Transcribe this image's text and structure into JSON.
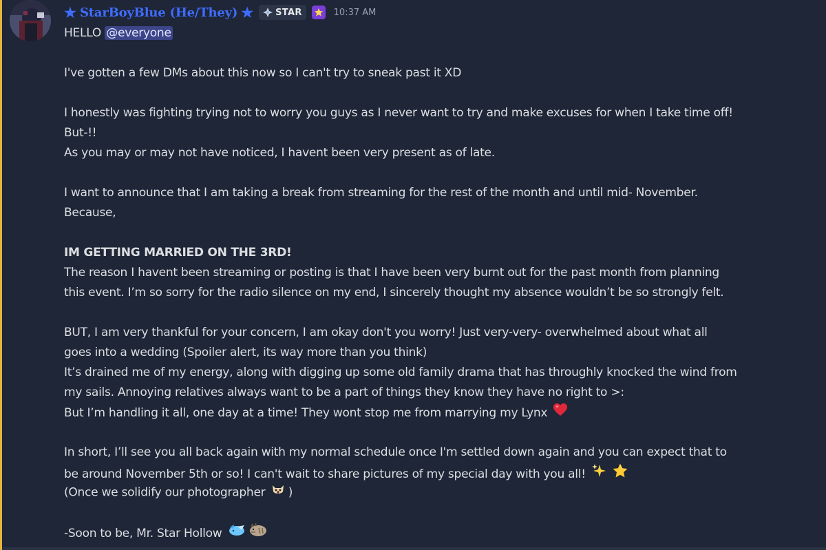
{
  "message": {
    "author": {
      "name": "StarBoyBlue (He/They)",
      "star_left": "★",
      "star_right": "★",
      "tag_label": "STAR",
      "role_icon": "star-badge-icon",
      "timestamp": "10:37 AM"
    },
    "colors": {
      "username": "#3f6cff",
      "mention_bg": "#3c4587",
      "accent_border": "#e3b53e",
      "background": "#1e2637"
    },
    "lines": {
      "l1_text": "HELLO ",
      "l1_mention": "@everyone",
      "l2": "I've gotten a few DMs about this now so I can't try to sneak past it XD",
      "l3": "I honestly was fighting trying not to worry you guys as I never want to try and make excuses for when I take time off!",
      "l4": "But-!!",
      "l5": "As you may or may not have noticed, I havent been very present as of late.",
      "l6": "I want to announce that I am taking a break from streaming for the rest of the month and until mid- November.",
      "l7": "Because,",
      "l8": "IM GETTING MARRIED ON THE 3RD!",
      "l9": "The reason I havent been streaming or posting is that I have been very burnt out for the past month from planning",
      "l10": "this event. I’m so sorry for the radio silence on my end, I sincerely thought my absence wouldn’t be so strongly felt.",
      "l11": "BUT, I am very thankful for your concern, I am okay don't you worry! Just very-very- overwhelmed about what all",
      "l12": "goes into a wedding (Spoiler alert, its way more than you think)",
      "l13": "It’s drained me of my energy, along with digging up some old family drama that has throughly knocked the wind from",
      "l14": "my sails. Annoying relatives always want to be a part of things they know they have no right to >:",
      "l15": "But I’m handling it all, one day at a time! They wont stop me from marrying my Lynx",
      "l16": "In short, I’ll see you all back again with my normal schedule once I'm settled down again and you can expect that to",
      "l17": "be around November 5th or so! I can't wait to share pictures of my special day with you all!",
      "l18_a": "(Once we solidify our photographer",
      "l18_b": ")",
      "l19": "-Soon to be, Mr. Star Hollow"
    },
    "emojis": {
      "heart": "red-heart-icon",
      "sparkles": "sparkles-icon",
      "star": "star-icon",
      "photographer": "cat-face-icon",
      "signature_1": "blue-star-creature-icon",
      "signature_2": "lynx-icon"
    }
  }
}
